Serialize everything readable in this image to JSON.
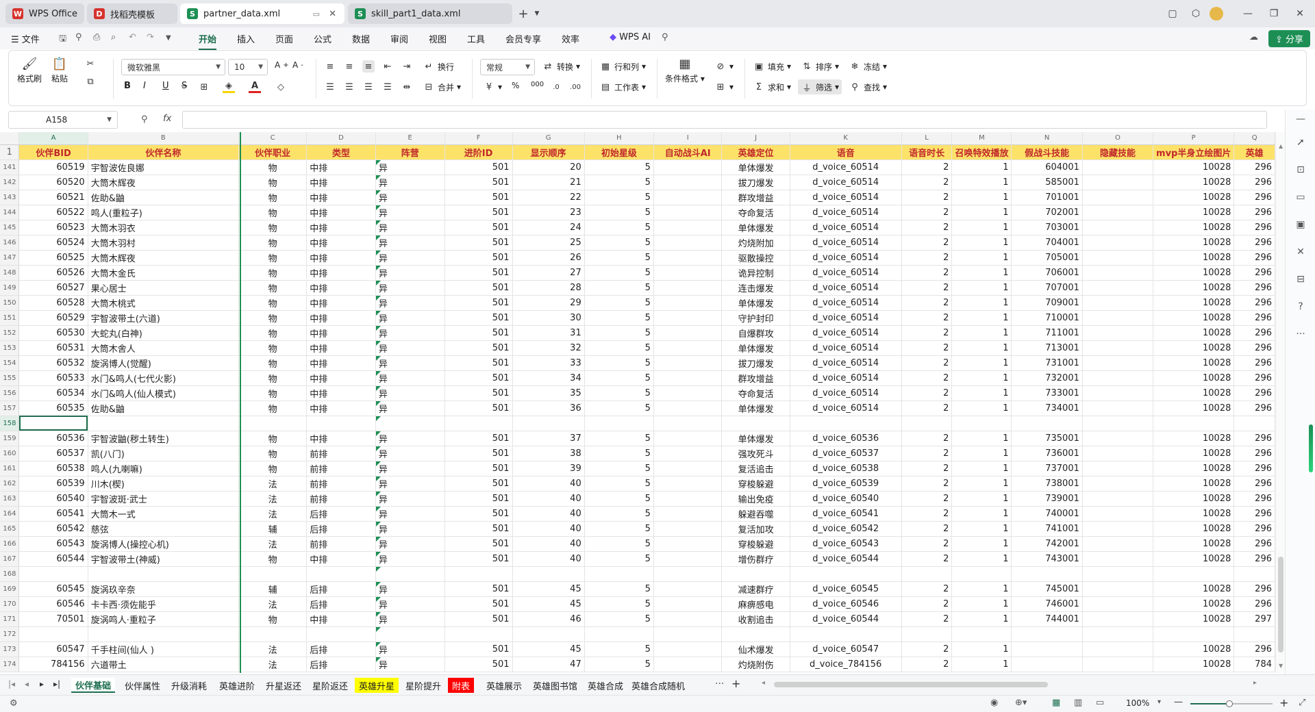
{
  "window": {
    "tabs": [
      {
        "label": "WPS Office",
        "color": "#d6322d",
        "glyph": "W"
      },
      {
        "label": "找稻壳模板",
        "color": "#d6322d",
        "glyph": "D"
      },
      {
        "label": "partner_data.xml",
        "color": "#1d8f55",
        "glyph": "S"
      },
      {
        "label": "skill_part1_data.xml",
        "color": "#1d8f55",
        "glyph": "S"
      }
    ],
    "new_tab": "+"
  },
  "menu": {
    "items": [
      "文件",
      "开始",
      "插入",
      "页面",
      "公式",
      "数据",
      "审阅",
      "视图",
      "工具",
      "会员专享",
      "效率"
    ],
    "active": "开始",
    "wps_ai": "WPS AI",
    "share": "分享"
  },
  "ribbon": {
    "format_painter": "格式刷",
    "paste": "粘贴",
    "font_name": "微软雅黑",
    "font_size": "10",
    "bold": "B",
    "italic": "I",
    "underline": "U",
    "strike": "S",
    "wrap": "换行",
    "merge": "合并",
    "number_format": "常规",
    "convert": "转换",
    "rowcol": "行和列",
    "worksheet": "工作表",
    "cond_format": "条件格式",
    "fill": "填充",
    "sort": "排序",
    "freeze": "冻结",
    "sum": "求和",
    "filter": "筛选",
    "find": "查找",
    "percent": "%",
    "thousands": "000"
  },
  "formula": {
    "cell_ref": "A158",
    "fx": "fx",
    "content": ""
  },
  "columns": [
    "A",
    "B",
    "C",
    "D",
    "E",
    "F",
    "G",
    "H",
    "I",
    "J",
    "K",
    "L",
    "M",
    "N",
    "O",
    "P",
    "Q"
  ],
  "headers": [
    "伙伴BID",
    "伙伴名称",
    "伙伴职业",
    "类型",
    "阵营",
    "进阶ID",
    "显示顺序",
    "初始星级",
    "自动战斗AI",
    "英雄定位",
    "语音",
    "语音时长",
    "召唤特效播放",
    "假战斗技能",
    "隐藏技能",
    "mvp半身立绘图片",
    "英雄"
  ],
  "rows": [
    [
      "141",
      "60519",
      "宇智波佐良娜",
      "物",
      "中排",
      "异",
      "501",
      "20",
      "5",
      "",
      "单体爆发",
      "d_voice_60514",
      "2",
      "1",
      "604001",
      "",
      "10028",
      "296"
    ],
    [
      "142",
      "60520",
      "大筒木辉夜",
      "物",
      "中排",
      "异",
      "501",
      "21",
      "5",
      "",
      "拔刀爆发",
      "d_voice_60514",
      "2",
      "1",
      "585001",
      "",
      "10028",
      "296"
    ],
    [
      "143",
      "60521",
      "佐助&鼬",
      "物",
      "中排",
      "异",
      "501",
      "22",
      "5",
      "",
      "群攻增益",
      "d_voice_60514",
      "2",
      "1",
      "701001",
      "",
      "10028",
      "296"
    ],
    [
      "144",
      "60522",
      "鸣人(重粒子)",
      "物",
      "中排",
      "异",
      "501",
      "23",
      "5",
      "",
      "夺命复活",
      "d_voice_60514",
      "2",
      "1",
      "702001",
      "",
      "10028",
      "296"
    ],
    [
      "145",
      "60523",
      "大筒木羽衣",
      "物",
      "中排",
      "异",
      "501",
      "24",
      "5",
      "",
      "单体爆发",
      "d_voice_60514",
      "2",
      "1",
      "703001",
      "",
      "10028",
      "296"
    ],
    [
      "146",
      "60524",
      "大筒木羽村",
      "物",
      "中排",
      "异",
      "501",
      "25",
      "5",
      "",
      "灼烧附加",
      "d_voice_60514",
      "2",
      "1",
      "704001",
      "",
      "10028",
      "296"
    ],
    [
      "147",
      "60525",
      "大筒木辉夜",
      "物",
      "中排",
      "异",
      "501",
      "26",
      "5",
      "",
      "驱散操控",
      "d_voice_60514",
      "2",
      "1",
      "705001",
      "",
      "10028",
      "296"
    ],
    [
      "148",
      "60526",
      "大筒木金氏",
      "物",
      "中排",
      "异",
      "501",
      "27",
      "5",
      "",
      "诡异控制",
      "d_voice_60514",
      "2",
      "1",
      "706001",
      "",
      "10028",
      "296"
    ],
    [
      "149",
      "60527",
      "果心居士",
      "物",
      "中排",
      "异",
      "501",
      "28",
      "5",
      "",
      "连击爆发",
      "d_voice_60514",
      "2",
      "1",
      "707001",
      "",
      "10028",
      "296"
    ],
    [
      "150",
      "60528",
      "大筒木桃式",
      "物",
      "中排",
      "异",
      "501",
      "29",
      "5",
      "",
      "单体爆发",
      "d_voice_60514",
      "2",
      "1",
      "709001",
      "",
      "10028",
      "296"
    ],
    [
      "151",
      "60529",
      "宇智波带土(六道)",
      "物",
      "中排",
      "异",
      "501",
      "30",
      "5",
      "",
      "守护封印",
      "d_voice_60514",
      "2",
      "1",
      "710001",
      "",
      "10028",
      "296"
    ],
    [
      "152",
      "60530",
      "大蛇丸(白神)",
      "物",
      "中排",
      "异",
      "501",
      "31",
      "5",
      "",
      "自爆群攻",
      "d_voice_60514",
      "2",
      "1",
      "711001",
      "",
      "10028",
      "296"
    ],
    [
      "153",
      "60531",
      "大筒木舍人",
      "物",
      "中排",
      "异",
      "501",
      "32",
      "5",
      "",
      "单体爆发",
      "d_voice_60514",
      "2",
      "1",
      "713001",
      "",
      "10028",
      "296"
    ],
    [
      "154",
      "60532",
      "旋涡博人(觉醒)",
      "物",
      "中排",
      "异",
      "501",
      "33",
      "5",
      "",
      "拔刀爆发",
      "d_voice_60514",
      "2",
      "1",
      "731001",
      "",
      "10028",
      "296"
    ],
    [
      "155",
      "60533",
      "水门&鸣人(七代火影)",
      "物",
      "中排",
      "异",
      "501",
      "34",
      "5",
      "",
      "群攻增益",
      "d_voice_60514",
      "2",
      "1",
      "732001",
      "",
      "10028",
      "296"
    ],
    [
      "156",
      "60534",
      "水门&鸣人(仙人模式)",
      "物",
      "中排",
      "异",
      "501",
      "35",
      "5",
      "",
      "夺命复活",
      "d_voice_60514",
      "2",
      "1",
      "733001",
      "",
      "10028",
      "296"
    ],
    [
      "157",
      "60535",
      "佐助&鼬",
      "物",
      "中排",
      "异",
      "501",
      "36",
      "5",
      "",
      "单体爆发",
      "d_voice_60514",
      "2",
      "1",
      "734001",
      "",
      "10028",
      "296"
    ],
    [
      "158",
      "",
      "",
      "",
      "",
      "",
      "",
      "",
      "",
      "",
      "",
      "",
      "",
      "",
      "",
      "",
      "",
      ""
    ],
    [
      "159",
      "60536",
      "宇智波鼬(秽土转生)",
      "物",
      "中排",
      "异",
      "501",
      "37",
      "5",
      "",
      "单体爆发",
      "d_voice_60536",
      "2",
      "1",
      "735001",
      "",
      "10028",
      "296"
    ],
    [
      "160",
      "60537",
      "凯(八门)",
      "物",
      "前排",
      "异",
      "501",
      "38",
      "5",
      "",
      "强攻死斗",
      "d_voice_60537",
      "2",
      "1",
      "736001",
      "",
      "10028",
      "296"
    ],
    [
      "161",
      "60538",
      "鸣人(九喇嘛)",
      "物",
      "前排",
      "异",
      "501",
      "39",
      "5",
      "",
      "复活追击",
      "d_voice_60538",
      "2",
      "1",
      "737001",
      "",
      "10028",
      "296"
    ],
    [
      "162",
      "60539",
      "川木(楔)",
      "法",
      "前排",
      "异",
      "501",
      "40",
      "5",
      "",
      "穿梭躲避",
      "d_voice_60539",
      "2",
      "1",
      "738001",
      "",
      "10028",
      "296"
    ],
    [
      "163",
      "60540",
      "宇智波斑·武士",
      "法",
      "前排",
      "异",
      "501",
      "40",
      "5",
      "",
      "输出免疫",
      "d_voice_60540",
      "2",
      "1",
      "739001",
      "",
      "10028",
      "296"
    ],
    [
      "164",
      "60541",
      "大筒木一式",
      "法",
      "后排",
      "异",
      "501",
      "40",
      "5",
      "",
      "躲避吞噬",
      "d_voice_60541",
      "2",
      "1",
      "740001",
      "",
      "10028",
      "296"
    ],
    [
      "165",
      "60542",
      "慈弦",
      "辅",
      "后排",
      "异",
      "501",
      "40",
      "5",
      "",
      "复活加攻",
      "d_voice_60542",
      "2",
      "1",
      "741001",
      "",
      "10028",
      "296"
    ],
    [
      "166",
      "60543",
      "旋涡博人(操控心机)",
      "法",
      "前排",
      "异",
      "501",
      "40",
      "5",
      "",
      "穿梭躲避",
      "d_voice_60543",
      "2",
      "1",
      "742001",
      "",
      "10028",
      "296"
    ],
    [
      "167",
      "60544",
      "宇智波带土(神威)",
      "物",
      "中排",
      "异",
      "501",
      "40",
      "5",
      "",
      "增伤群疗",
      "d_voice_60544",
      "2",
      "1",
      "743001",
      "",
      "10028",
      "296"
    ],
    [
      "168",
      "",
      "",
      "",
      "",
      "",
      "",
      "",
      "",
      "",
      "",
      "",
      "",
      "",
      "",
      "",
      "",
      ""
    ],
    [
      "169",
      "60545",
      "旋涡玖辛奈",
      "辅",
      "后排",
      "异",
      "501",
      "45",
      "5",
      "",
      "减速群疗",
      "d_voice_60545",
      "2",
      "1",
      "745001",
      "",
      "10028",
      "296"
    ],
    [
      "170",
      "60546",
      "卡卡西·须佐能乎",
      "法",
      "后排",
      "异",
      "501",
      "45",
      "5",
      "",
      "麻痹感电",
      "d_voice_60546",
      "2",
      "1",
      "746001",
      "",
      "10028",
      "296"
    ],
    [
      "171",
      "70501",
      "旋涡鸣人·重粒子",
      "物",
      "中排",
      "异",
      "501",
      "46",
      "5",
      "",
      "收割追击",
      "d_voice_60544",
      "2",
      "1",
      "744001",
      "",
      "10028",
      "297"
    ],
    [
      "172",
      "",
      "",
      "",
      "",
      "",
      "",
      "",
      "",
      "",
      "",
      "",
      "",
      "",
      "",
      "",
      "",
      ""
    ],
    [
      "173",
      "60547",
      "千手柱间(仙人 )",
      "法",
      "后排",
      "异",
      "501",
      "45",
      "5",
      "",
      "仙术爆发",
      "d_voice_60547",
      "2",
      "1",
      "",
      "",
      "10028",
      "296"
    ],
    [
      "174",
      "784156",
      "六道带土",
      "法",
      "后排",
      "异",
      "501",
      "47",
      "5",
      "",
      "灼烧附伤",
      "d_voice_784156",
      "2",
      "1",
      "",
      "",
      "10028",
      "784"
    ]
  ],
  "sheets": [
    {
      "label": "伙伴基础",
      "bg": "",
      "active": true
    },
    {
      "label": "伙伴属性",
      "bg": ""
    },
    {
      "label": "升级消耗",
      "bg": ""
    },
    {
      "label": "英雄进阶",
      "bg": ""
    },
    {
      "label": "升星返还",
      "bg": ""
    },
    {
      "label": "星阶返还",
      "bg": ""
    },
    {
      "label": "英雄升星",
      "bg": "#ffff00"
    },
    {
      "label": "星阶提升",
      "bg": ""
    },
    {
      "label": "附表",
      "bg": "#ff0000",
      "fg": "#ffffff"
    },
    {
      "label": "英雄展示",
      "bg": ""
    },
    {
      "label": "英雄图书馆",
      "bg": ""
    },
    {
      "label": "英雄合成",
      "bg": ""
    },
    {
      "label": "英雄合成随机",
      "bg": ""
    }
  ],
  "status": {
    "zoom": "100%",
    "more": "···",
    "add": "+"
  }
}
